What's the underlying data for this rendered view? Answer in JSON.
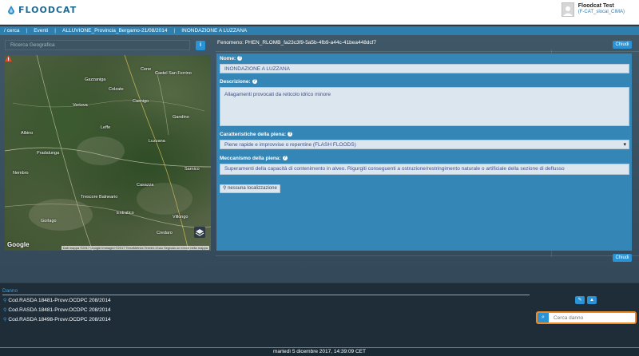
{
  "app": {
    "logo_text": "FLOODCAT"
  },
  "user": {
    "name": "Floodcat Test",
    "org": "(F-CAT_slocal_CIMA)"
  },
  "breadcrumb": {
    "items": [
      "/ cerca",
      "Eventi",
      "ALLUVIONE_Provincia_Bergamo-21/08/2014",
      "INONDAZIONE A LUZZANA"
    ]
  },
  "left": {
    "search_placeholder": "Ricerca Geografica",
    "info_label": "i",
    "map": {
      "places": [
        "Cene",
        "Gazzaniga",
        "Colzate",
        "Casnigo",
        "Vertova",
        "Gandino",
        "Leffe",
        "Albino",
        "Pradalunga",
        "Nembro",
        "Casazza",
        "Trescore Balneario",
        "Entratico",
        "Luzzana",
        "Gorlago",
        "Villongo",
        "Credaro",
        "Sarnico",
        "Castel San Ferrino"
      ],
      "google_label": "Google",
      "attribution": "Dati mappa ©2017 Google Immagini ©2017 TerraMetrics   Termini d'uso   Segnala un errore nella mappa"
    }
  },
  "right": {
    "fenomeno": "Fenomeno: PHEN_RLOMB_fa23c3f9-5a5b-4fb9-a44c-41bea448dcf7",
    "close_label": "Chiudi",
    "fields": {
      "nome_label": "Nome:",
      "nome_value": "INONDAZIONE A LUZZANA",
      "descrizione_label": "Descrizione:",
      "descrizione_value": "Allagamenti provocati da reticolo idrico minore",
      "caratteristiche_label": "Caratteristiche della piena:",
      "caratteristiche_value": "Piene rapide e improvvise o repentine (FLASH FLOODS)",
      "meccanismo_label": "Meccanismo della piena:",
      "meccanismo_value": "Superamenti della capacità di contenimento in alveo.  Rigurgiti conseguenti a ostruzione/restringimento naturale o artificiale della sezione di deflusso"
    },
    "location_label": "nessuna localizzazione",
    "help_glyph": "?"
  },
  "danno": {
    "title": "Danno",
    "items": [
      "Cod.RASDA 18481-Provv.OCDPC 208/2014",
      "Cod.RASDA 18481-Provv.OCDPC 208/2014",
      "Cod.RASDA 18498-Provv.OCDPC 208/2014"
    ],
    "search_placeholder": "Cerca danno"
  },
  "footer": {
    "datetime": "martedì 5 dicembre 2017, 14:39:09 CET"
  }
}
